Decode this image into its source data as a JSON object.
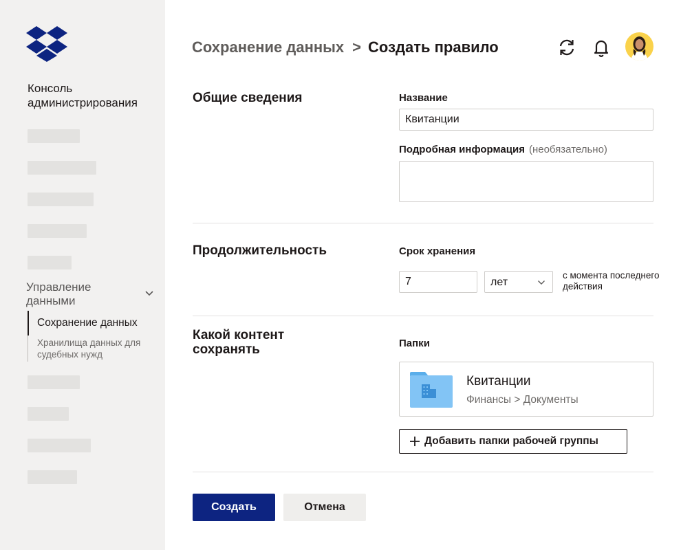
{
  "sidebar": {
    "console_title": "Консоль администрирования",
    "group_label": "Управление данными",
    "sub_items": [
      {
        "label": "Сохранение данных",
        "active": true
      },
      {
        "label": "Хранилища данных для судебных нужд",
        "active": false
      }
    ]
  },
  "header": {
    "breadcrumb_parent": "Сохранение данных",
    "separator": ">",
    "breadcrumb_current": "Создать правило",
    "icons": [
      "sync-icon",
      "bell-icon",
      "avatar"
    ]
  },
  "general": {
    "section_title": "Общие сведения",
    "name_label": "Название",
    "name_value": "Квитанции",
    "details_label": "Подробная информация",
    "details_optional": "(необязательно)",
    "details_value": ""
  },
  "duration": {
    "section_title": "Продолжительность",
    "retention_label": "Срок хранения",
    "retention_value": "7",
    "unit_value": "лет",
    "since_text": "с момента последнего действия"
  },
  "content": {
    "section_title": "Какой контент сохранять",
    "folders_label": "Папки",
    "folder_name": "Квитанции",
    "folder_path": "Финансы > Документы",
    "add_button": "Добавить папки рабочей группы"
  },
  "actions": {
    "create": "Создать",
    "cancel": "Отмена"
  },
  "colors": {
    "primary_button": "#0d2481",
    "dropbox_blue": "#0d2481",
    "folder_blue": "#82c4f5",
    "sidebar_bg": "#f2f1f0",
    "avatar_bg": "#fad24b"
  }
}
